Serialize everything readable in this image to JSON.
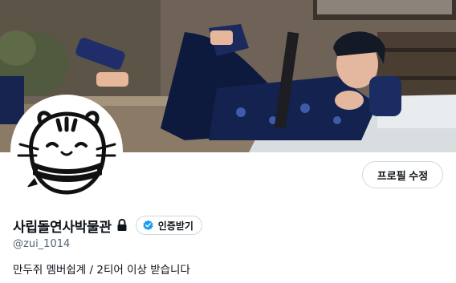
{
  "profile": {
    "display_name": "사립돌연사박물관",
    "handle": "@zui_1014",
    "bio": "만두쥐 멤버쉽계 / 2티어 이상 받습니다",
    "edit_profile_label": "프로필 수정",
    "get_verified_label": "인증받기"
  },
  "icons": {
    "lock": "lock-icon",
    "verified": "verified-badge-icon"
  },
  "colors": {
    "verified_blue": "#1d9bf0",
    "text_primary": "#0f1419",
    "text_secondary": "#536471",
    "border": "#cfd9de"
  }
}
